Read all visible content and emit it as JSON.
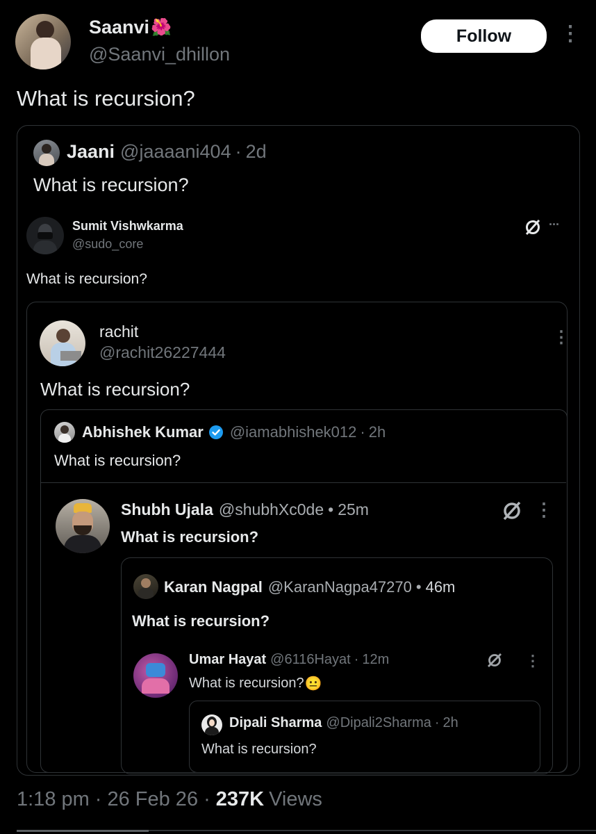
{
  "author": {
    "name": "Saanvi",
    "handle": "@Saanvi_dhillon",
    "emoji": "🌺"
  },
  "follow_label": "Follow",
  "post_text": "What is recursion?",
  "quotes": [
    {
      "name": "Jaani",
      "handle": "@jaaaani404",
      "sep": "·",
      "time": "2d",
      "text": "What is recursion?"
    },
    {
      "name": "Sumit Vishwkarma",
      "handle": "@sudo_core",
      "text": "What is recursion?"
    },
    {
      "name": "rachit",
      "handle": "@rachit26227444",
      "text": "What is recursion?"
    },
    {
      "name": "Abhishek Kumar",
      "handle": "@iamabhishek012",
      "sep": "·",
      "time": "2h",
      "text": "What is recursion?"
    },
    {
      "name": "Shubh Ujala",
      "handle": "@shubhXc0de",
      "sep": "•",
      "time": "25m",
      "text": "What is recursion?"
    },
    {
      "name": "Karan Nagpal",
      "handle": "@KaranNagpa47270",
      "sep": "•",
      "time": "46m",
      "text": "What is recursion?"
    },
    {
      "name": "Umar Hayat",
      "handle": "@6116Hayat",
      "sep": "·",
      "time": "12m",
      "text": "What is recursion?",
      "emoji": "😐"
    },
    {
      "name": "Dipali Sharma",
      "handle": "@Dipali2Sharma",
      "sep": "·",
      "time": "2h",
      "text": "What is recursion?"
    }
  ],
  "footer": {
    "time": "1:18 pm",
    "sep1": "·",
    "date": "26 Feb 26",
    "sep2": "·",
    "views_count": "237K",
    "views_label": "Views"
  },
  "icons": {
    "more_vertical": "⋮",
    "more_horizontal": "···",
    "grok_icon": "grok-slash-circle",
    "verified_color": "#1d9bf0"
  }
}
